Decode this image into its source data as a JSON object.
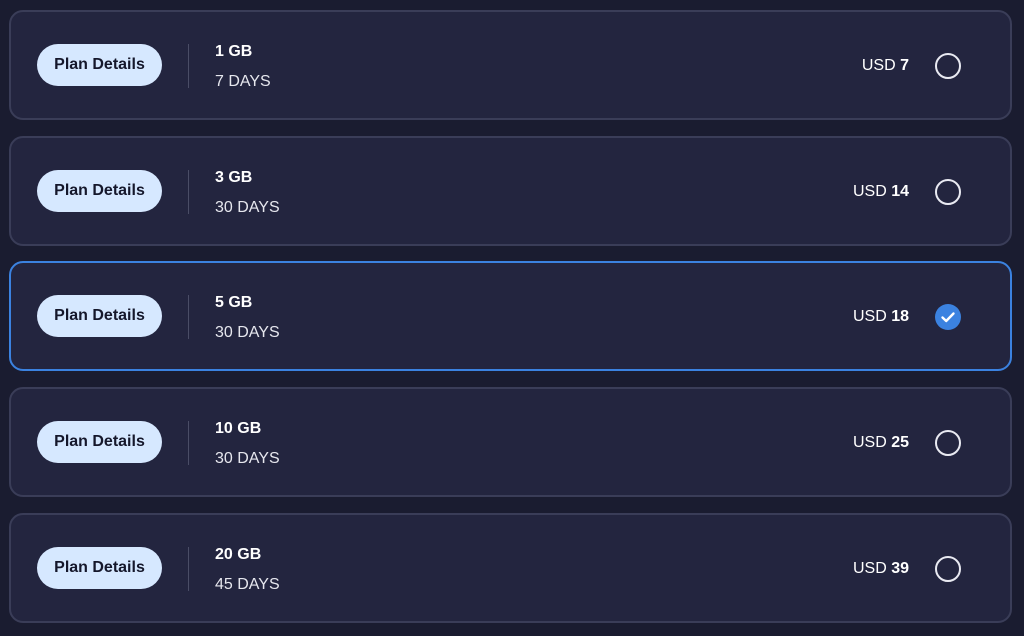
{
  "plans": [
    {
      "button_label": "Plan Details",
      "size": "1 GB",
      "duration": "7 DAYS",
      "currency": "USD",
      "amount": "7",
      "selected": false
    },
    {
      "button_label": "Plan Details",
      "size": "3 GB",
      "duration": "30 DAYS",
      "currency": "USD",
      "amount": "14",
      "selected": false
    },
    {
      "button_label": "Plan Details",
      "size": "5 GB",
      "duration": "30 DAYS",
      "currency": "USD",
      "amount": "18",
      "selected": true
    },
    {
      "button_label": "Plan Details",
      "size": "10 GB",
      "duration": "30 DAYS",
      "currency": "USD",
      "amount": "25",
      "selected": false
    },
    {
      "button_label": "Plan Details",
      "size": "20 GB",
      "duration": "45 DAYS",
      "currency": "USD",
      "amount": "39",
      "selected": false
    }
  ],
  "icons": {
    "unselected": "radio-empty-icon",
    "selected": "check-icon"
  },
  "colors": {
    "page_background": "#1a1c30",
    "card_background": "#23253f",
    "card_border": "#3a3d58",
    "selected_accent": "#3b82e0",
    "button_background": "#d6e8ff"
  }
}
